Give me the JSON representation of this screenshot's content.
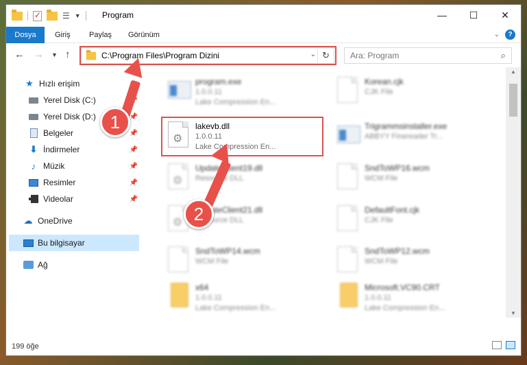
{
  "window": {
    "title": "Program",
    "controls": {
      "minimize": "—",
      "maximize": "☐",
      "close": "✕"
    }
  },
  "ribbon": {
    "tabs": [
      "Dosya",
      "Giriş",
      "Paylaş",
      "Görünüm"
    ],
    "help": "?"
  },
  "nav": {
    "address_path": "C:\\Program Files\\Program Dizini",
    "search_placeholder": "Ara: Program"
  },
  "sidebar": {
    "items": [
      {
        "label": "Hızlı erişim",
        "icon": "star-icon"
      },
      {
        "label": "Yerel Disk (C:)",
        "icon": "disk-icon",
        "pinned": true
      },
      {
        "label": "Yerel Disk (D:)",
        "icon": "disk-icon",
        "pinned": true
      },
      {
        "label": "Belgeler",
        "icon": "document-icon",
        "pinned": true
      },
      {
        "label": "İndirmeler",
        "icon": "download-icon",
        "pinned": true
      },
      {
        "label": "Müzik",
        "icon": "music-icon",
        "pinned": true
      },
      {
        "label": "Resimler",
        "icon": "picture-icon",
        "pinned": true
      },
      {
        "label": "Videolar",
        "icon": "video-icon",
        "pinned": true
      },
      {
        "label": "OneDrive",
        "icon": "cloud-icon"
      },
      {
        "label": "Bu bilgisayar",
        "icon": "computer-icon",
        "selected": true
      },
      {
        "label": "Ağ",
        "icon": "network-icon"
      }
    ]
  },
  "files": [
    {
      "name": "program.exe",
      "line1": "1.0.0.11",
      "line2": "Lake Compression En...",
      "icon": "exe-icon",
      "blurred": true
    },
    {
      "name": "Korean.cjk",
      "line1": "CJK File",
      "line2": "",
      "icon": "document-icon",
      "blurred": true
    },
    {
      "name": "lakevb.dll",
      "line1": "1.0.0.11",
      "line2": "Lake Compression En...",
      "icon": "dll-gear-icon",
      "blurred": false
    },
    {
      "name": "Trigrammsinstaller.exe",
      "line1": "ABBYY Finereader Tr...",
      "line2": "",
      "icon": "exe-icon",
      "blurred": true
    },
    {
      "name": "UpdateClient19.dll",
      "line1": "Resource DLL",
      "line2": "",
      "icon": "dll-gear-icon",
      "blurred": true
    },
    {
      "name": "SndToWP16.wcm",
      "line1": "WCM File",
      "line2": "",
      "icon": "document-icon",
      "blurred": true
    },
    {
      "name": "UpdateClient21.dll",
      "line1": "Resource DLL",
      "line2": "",
      "icon": "dll-gear-icon",
      "blurred": true
    },
    {
      "name": "DefaultFont.cjk",
      "line1": "CJK File",
      "line2": "",
      "icon": "document-icon",
      "blurred": true
    },
    {
      "name": "SndToWP14.wcm",
      "line1": "WCM File",
      "line2": "",
      "icon": "document-icon",
      "blurred": true
    },
    {
      "name": "SndToWP12.wcm",
      "line1": "WCM File",
      "line2": "",
      "icon": "document-icon",
      "blurred": true
    },
    {
      "name": "x64",
      "line1": "1.0.0.11",
      "line2": "Lake Compression En...",
      "icon": "folder-icon",
      "blurred": true
    },
    {
      "name": "Microsoft.VC90.CRT",
      "line1": "1.0.0.11",
      "line2": "Lake Compression En...",
      "icon": "folder-icon",
      "blurred": true
    }
  ],
  "status": {
    "count": "199 öğe"
  },
  "annotations": {
    "step1": "1",
    "step2": "2"
  },
  "colors": {
    "accent": "#1979ca",
    "highlight": "#d9534f",
    "annotation": "#e8514a"
  }
}
